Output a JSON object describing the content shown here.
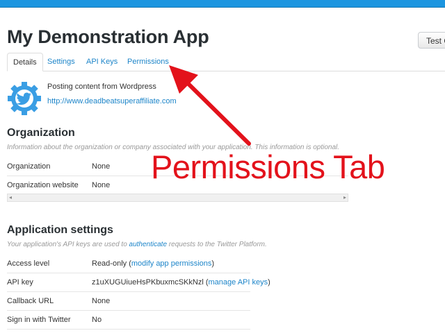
{
  "app": {
    "title": "My Demonstration App",
    "test_button": "Test O"
  },
  "tabs": [
    {
      "label": "Details",
      "active": true
    },
    {
      "label": "Settings",
      "active": false
    },
    {
      "label": "API Keys",
      "active": false
    },
    {
      "label": "Permissions",
      "active": false
    }
  ],
  "app_info": {
    "icon": "twitter-bird-gear-icon",
    "description": "Posting content from Wordpress",
    "url": "http://www.deadbeatsuperaffiliate.com"
  },
  "organization": {
    "title": "Organization",
    "note": "Information about the organization or company associated with your application. This information is optional.",
    "rows": [
      {
        "key": "Organization",
        "value": "None"
      },
      {
        "key": "Organization website",
        "value": "None"
      }
    ]
  },
  "application_settings": {
    "title": "Application settings",
    "note_prefix": "Your application's API keys are used to ",
    "note_link": "authenticate",
    "note_suffix": " requests to the Twitter Platform.",
    "rows": [
      {
        "key": "Access level",
        "value": "Read-only (",
        "link": "modify app permissions",
        "after": ")"
      },
      {
        "key": "API key",
        "value": "z1uXUGUiueHsPKbuxmcSKkNzl (",
        "link": "manage API keys",
        "after": ")"
      },
      {
        "key": "Callback URL",
        "value": "None"
      },
      {
        "key": "Sign in with Twitter",
        "value": "No"
      }
    ]
  },
  "annotation": {
    "text": "Permissions Tab",
    "color": "#e3121b"
  },
  "colors": {
    "accent": "#1b95e0",
    "link": "#1d85c9"
  }
}
